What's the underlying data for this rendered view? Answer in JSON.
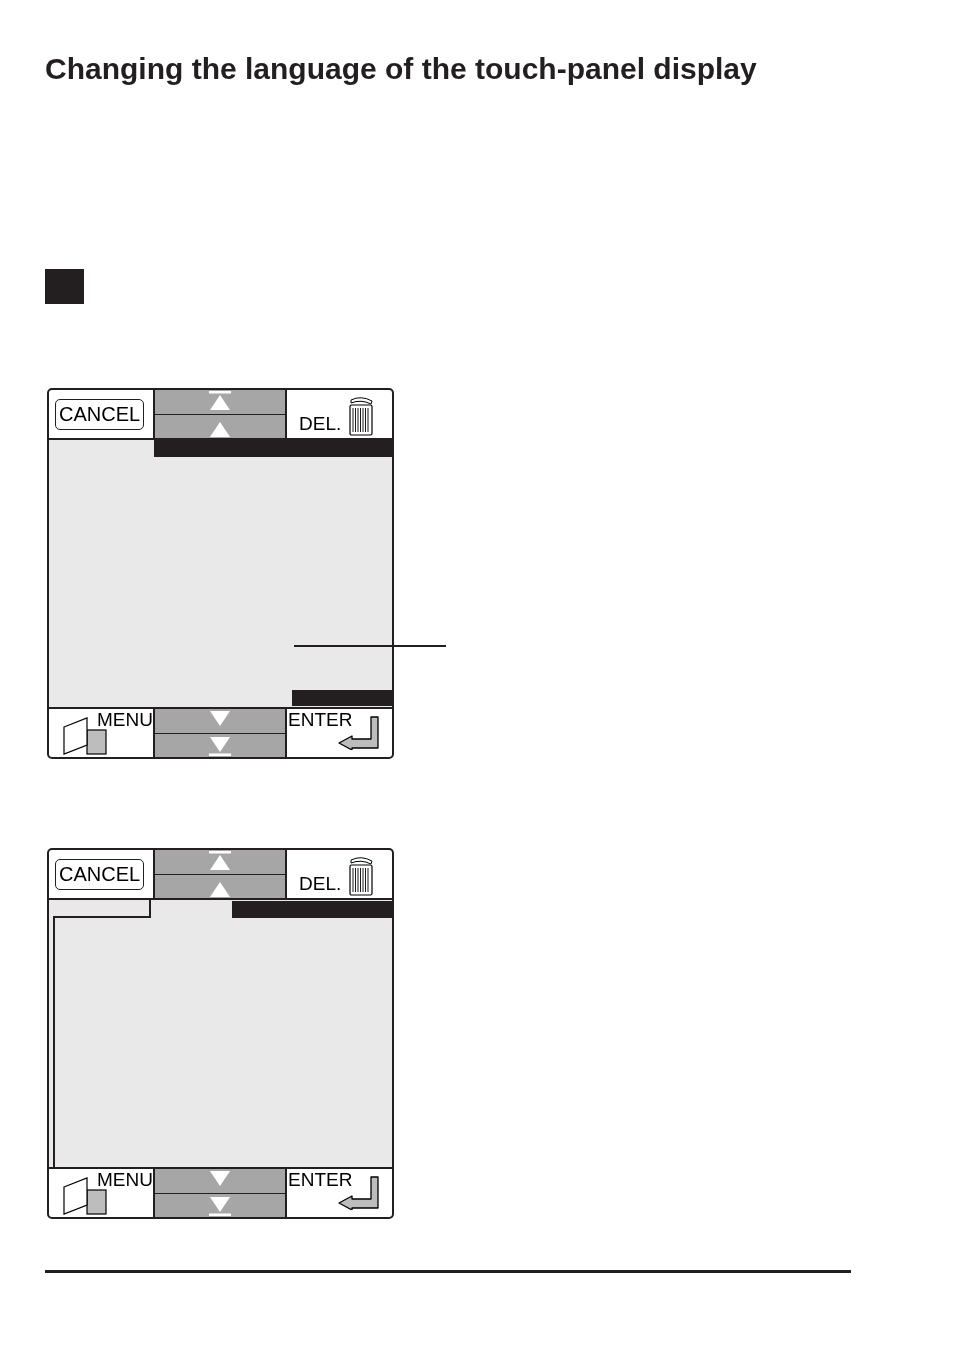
{
  "title": "Changing the language of the touch-panel display",
  "screens": [
    {
      "kind": "list",
      "cancel": "CANCEL",
      "delete": "DEL.",
      "menu": "MENU",
      "enter": "ENTER"
    },
    {
      "kind": "tabbed",
      "cancel": "CANCEL",
      "delete": "DEL.",
      "menu": "MENU",
      "enter": "ENTER"
    }
  ]
}
